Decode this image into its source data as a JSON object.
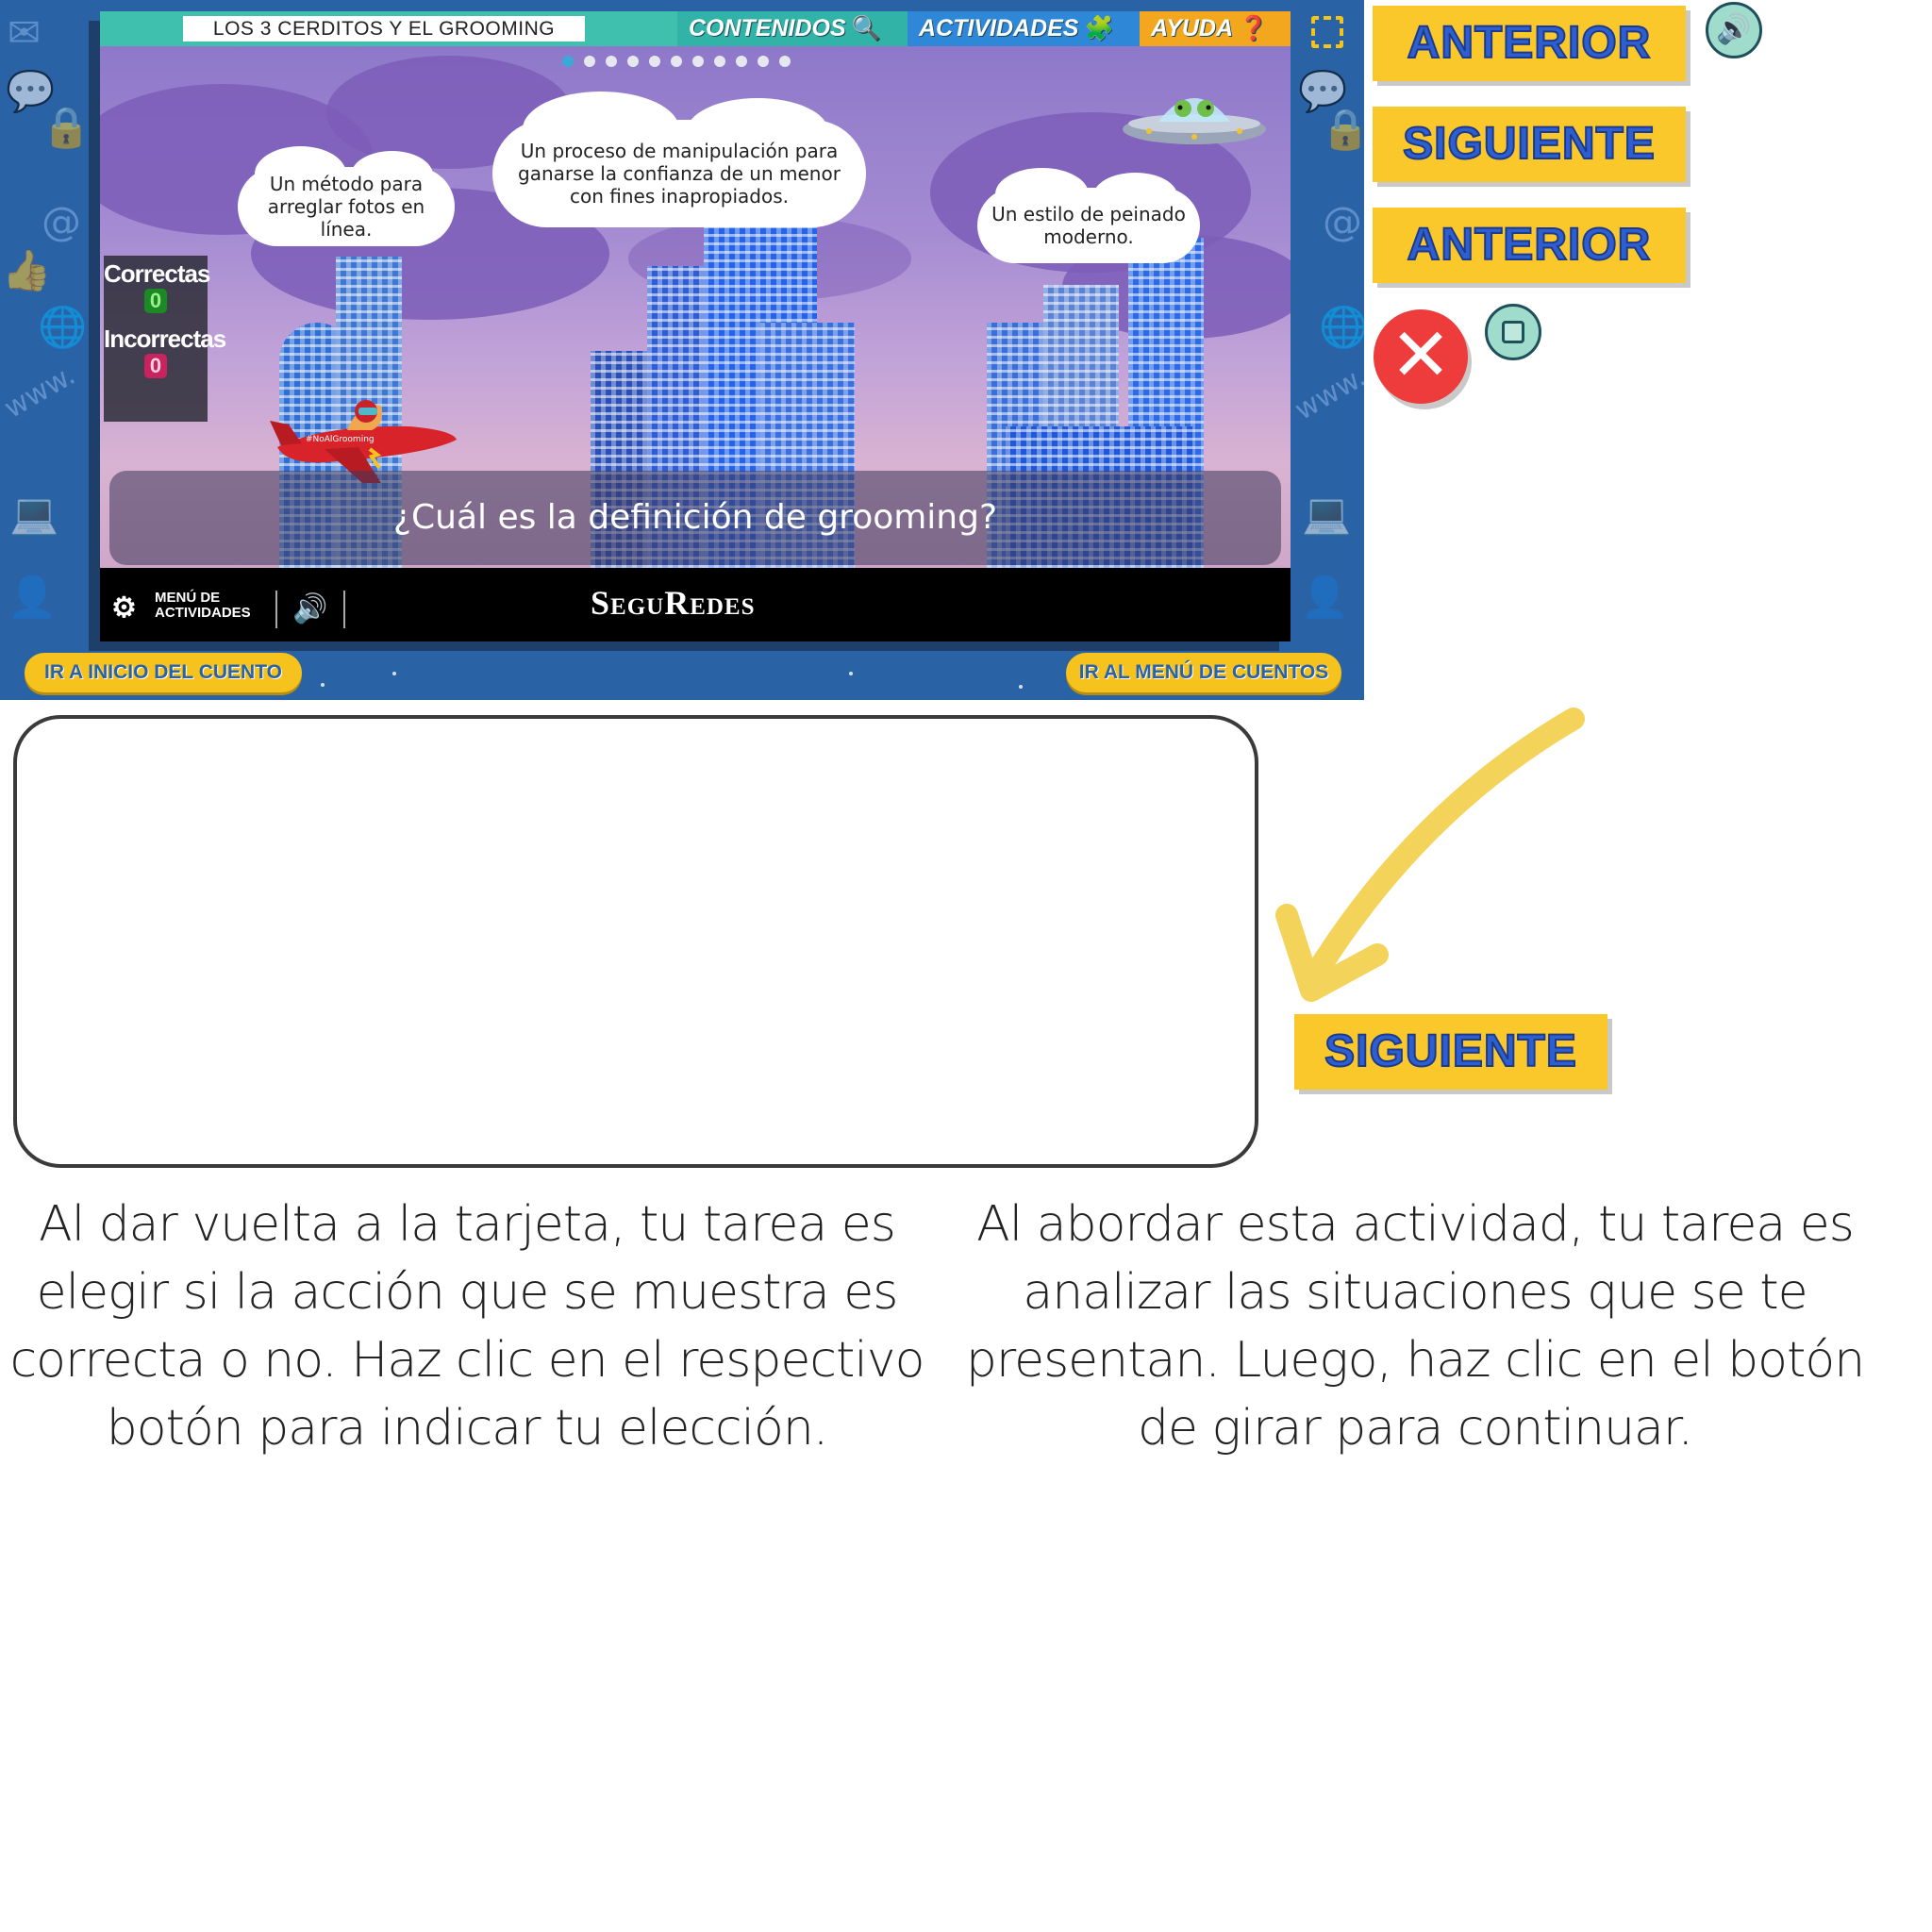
{
  "frame": {
    "story_title": "LOS 3 CERDITOS Y EL GROOMING",
    "nav": {
      "contenidos": "CONTENIDOS",
      "actividades": "ACTIVIDADES",
      "ayuda": "AYUDA"
    },
    "bubbles": {
      "left": "Un método para arreglar fotos en línea.",
      "center": "Un proceso de manipulación para ganarse la confianza de un menor con fines inapropiados.",
      "right": "Un estilo de peinado moderno."
    },
    "score": {
      "correct_label": "Correctas",
      "correct_value": "0",
      "wrong_label": "Incorrectas",
      "wrong_value": "0"
    },
    "plane_tag": "#NoAlGrooming",
    "question": "¿Cuál es la definición de grooming?",
    "bottom": {
      "activities_menu": "MENÚ DE ACTIVIDADES",
      "brand": "SeguRedes"
    },
    "footer": {
      "start": "IR A INICIO DEL CUENTO",
      "menu": "IR AL MENÚ DE CUENTOS"
    },
    "progress": {
      "total_dots": 11,
      "current": 1
    }
  },
  "buttons": {
    "prev_1": "ANTERIOR",
    "next_1": "SIGUIENTE",
    "prev_2": "ANTERIOR",
    "next_2": "SIGUIENTE"
  },
  "colors": {
    "frame_bg": "#2a62a6",
    "yellow_button": "#fbc82c",
    "wrong_red": "#ee3b3b",
    "arrow_yellow": "#f4d35a"
  },
  "instructions": {
    "left": "Al dar vuelta a la tarjeta, tu tarea es elegir si la acción que se muestra es correcta o no. Haz clic en el respectivo botón para indicar tu elección.",
    "right": "Al abordar esta actividad, tu tarea es analizar las situaciones que se te presentan. Luego, haz clic en el botón de girar para continuar."
  }
}
